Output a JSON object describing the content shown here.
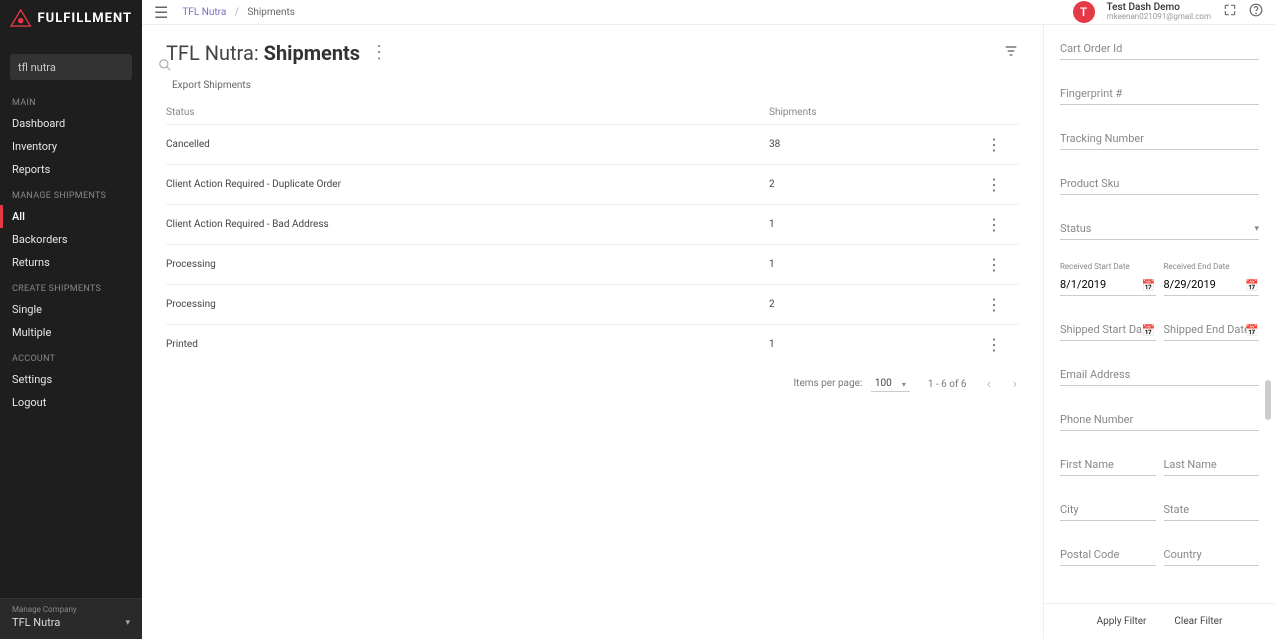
{
  "brand": {
    "line1": "FULFILLMENT"
  },
  "search": {
    "value": "tfl nutra"
  },
  "sidebar": {
    "sections": [
      {
        "title": "MAIN",
        "items": [
          "Dashboard",
          "Inventory",
          "Reports"
        ]
      },
      {
        "title": "MANAGE SHIPMENTS",
        "items": [
          "All",
          "Backorders",
          "Returns"
        ]
      },
      {
        "title": "CREATE SHIPMENTS",
        "items": [
          "Single",
          "Multiple"
        ]
      },
      {
        "title": "ACCOUNT",
        "items": [
          "Settings",
          "Logout"
        ]
      }
    ],
    "company_label": "Manage Company",
    "company_value": "TFL Nutra"
  },
  "breadcrumb": {
    "parent": "TFL Nutra",
    "current": "Shipments"
  },
  "user": {
    "initial": "T",
    "name": "Test Dash Demo",
    "email": "mkeenan021091@gmail.com"
  },
  "page": {
    "title_prefix": "TFL Nutra:",
    "title_main": "Shipments",
    "export_label": "Export Shipments"
  },
  "table": {
    "headers": {
      "status": "Status",
      "shipments": "Shipments"
    },
    "rows": [
      {
        "status": "Cancelled",
        "shipments": "38"
      },
      {
        "status": "Client Action Required - Duplicate Order",
        "shipments": "2"
      },
      {
        "status": "Client Action Required - Bad Address",
        "shipments": "1"
      },
      {
        "status": "Processing",
        "shipments": "1"
      },
      {
        "status": "Processing",
        "shipments": "2"
      },
      {
        "status": "Printed",
        "shipments": "1"
      }
    ],
    "paginator": {
      "items_per_page_label": "Items per page:",
      "items_per_page_value": "100",
      "range": "1 - 6 of 6"
    }
  },
  "filters": {
    "cart_order_id": "Cart Order Id",
    "fingerprint": "Fingerprint #",
    "tracking_number": "Tracking Number",
    "product_sku": "Product Sku",
    "status": "Status",
    "received_start_label": "Received Start Date",
    "received_start_value": "8/1/2019",
    "received_end_label": "Received End Date",
    "received_end_value": "8/29/2019",
    "shipped_start": "Shipped Start Da..",
    "shipped_end": "Shipped End Date",
    "email": "Email Address",
    "phone": "Phone Number",
    "first_name": "First Name",
    "last_name": "Last Name",
    "city": "City",
    "state": "State",
    "postal": "Postal Code",
    "country": "Country",
    "apply": "Apply Filter",
    "clear": "Clear Filter"
  }
}
